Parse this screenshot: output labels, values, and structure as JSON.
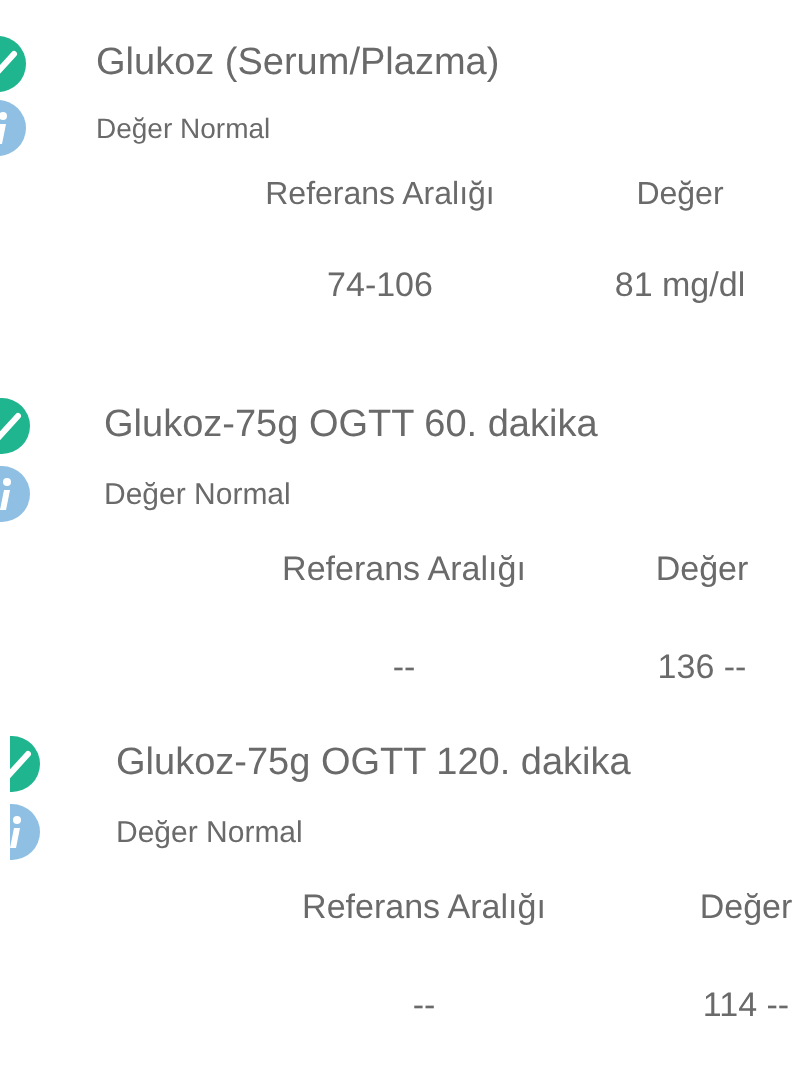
{
  "results": [
    {
      "title": "Glukoz (Serum/Plazma)",
      "status": "Değer Normal",
      "columns": [
        "Referans Aralığı",
        "Değer"
      ],
      "cells": [
        "74-106",
        "81 mg/dl"
      ]
    },
    {
      "title": "Glukoz-75g OGTT 60. dakika",
      "status": "Değer Normal",
      "columns": [
        "Referans Aralığı",
        "Değer"
      ],
      "cells": [
        "--",
        "136 --"
      ]
    },
    {
      "title": "Glukoz-75g OGTT 120. dakika",
      "status": "Değer Normal",
      "columns": [
        "Referans Aralığı",
        "Değer"
      ],
      "cells": [
        "--",
        "114 --"
      ]
    }
  ]
}
